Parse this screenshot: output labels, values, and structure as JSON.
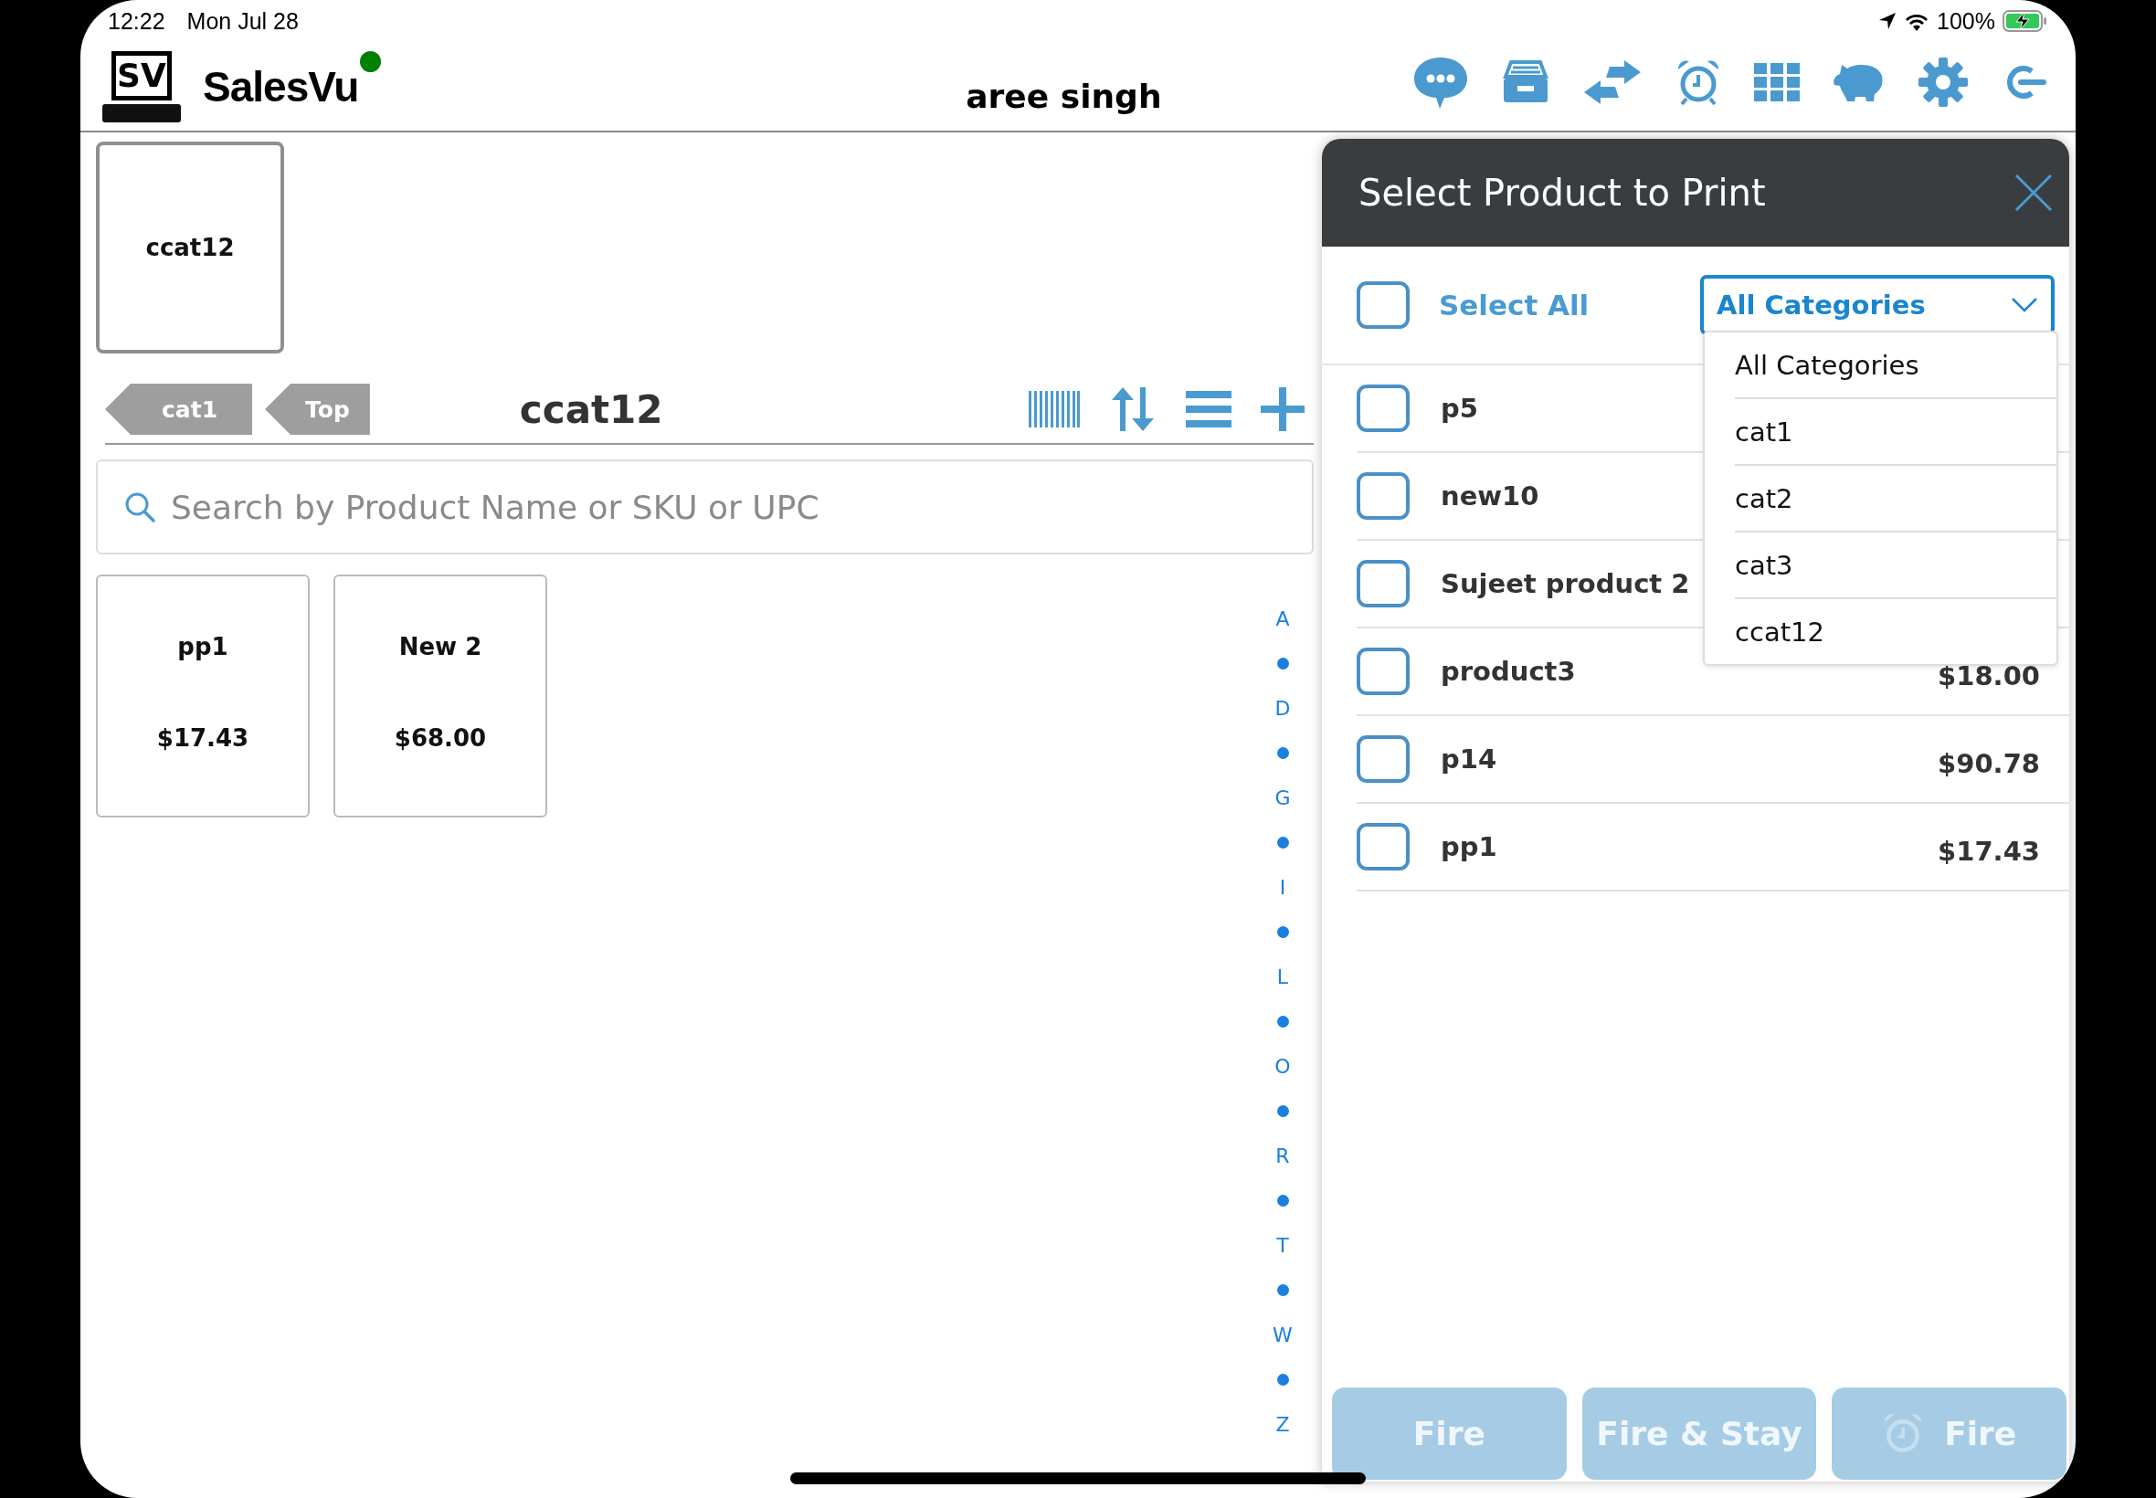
{
  "status_bar": {
    "time": "12:22",
    "date": "Mon Jul 28",
    "battery": "100%"
  },
  "header": {
    "logo_text": "SV",
    "app_name": "SalesVu",
    "online": true,
    "user": "aree singh"
  },
  "category_tiles": [
    {
      "label": "ccat12"
    }
  ],
  "breadcrumbs": [
    {
      "label": "cat1"
    },
    {
      "label": "Top"
    }
  ],
  "current_category": "ccat12",
  "search": {
    "placeholder": "Search by Product Name or SKU or UPC"
  },
  "products": [
    {
      "name": "pp1",
      "price": "$17.43"
    },
    {
      "name": "New 2",
      "price": "$68.00"
    }
  ],
  "alphabet_index": [
    {
      "kind": "letter",
      "label": "A"
    },
    {
      "kind": "dot"
    },
    {
      "kind": "letter",
      "label": "D"
    },
    {
      "kind": "dot"
    },
    {
      "kind": "letter",
      "label": "G"
    },
    {
      "kind": "dot"
    },
    {
      "kind": "letter",
      "label": "I"
    },
    {
      "kind": "dot"
    },
    {
      "kind": "letter",
      "label": "L"
    },
    {
      "kind": "dot"
    },
    {
      "kind": "letter",
      "label": "O"
    },
    {
      "kind": "dot"
    },
    {
      "kind": "letter",
      "label": "R"
    },
    {
      "kind": "dot"
    },
    {
      "kind": "letter",
      "label": "T"
    },
    {
      "kind": "dot"
    },
    {
      "kind": "letter",
      "label": "W"
    },
    {
      "kind": "dot"
    },
    {
      "kind": "letter",
      "label": "Z"
    }
  ],
  "print_dialog": {
    "title": "Select Product to Print",
    "select_all": {
      "label": "Select All",
      "checked": false
    },
    "category_filter": {
      "value": "All Categories",
      "expanded": true,
      "options": [
        "All Categories",
        "cat1",
        "cat2",
        "cat3",
        "ccat12"
      ]
    },
    "products": [
      {
        "name": "p5",
        "checked": false
      },
      {
        "name": "new10",
        "checked": false
      },
      {
        "name": "Sujeet product 2",
        "checked": false
      },
      {
        "name": "product3",
        "price": "$18.00",
        "checked": false
      },
      {
        "name": "p14",
        "price": "$90.78",
        "checked": false
      },
      {
        "name": "pp1",
        "price": "$17.43",
        "checked": false
      }
    ],
    "actions": [
      {
        "label": "Fire",
        "kind": "plain",
        "disabled": true
      },
      {
        "label": "Fire & Stay",
        "kind": "plain",
        "disabled": true
      },
      {
        "label": "Fire",
        "kind": "timed",
        "disabled": true
      }
    ]
  }
}
